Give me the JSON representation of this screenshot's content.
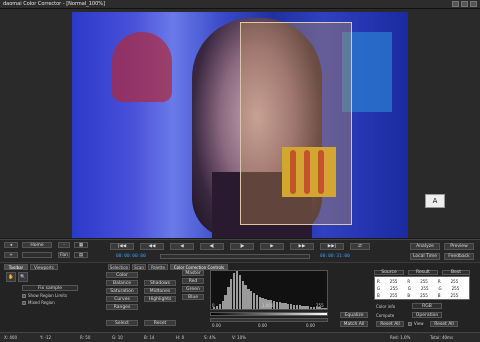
{
  "window": {
    "title": "daomai Color Corrector - [Normal_100%]"
  },
  "viewer": {
    "overlay_icon_label": "A"
  },
  "transport": {
    "left_controls": [
      "Home",
      "-",
      "Fan"
    ],
    "timecode_in": "00:00:00:00",
    "timecode_out": "00:00:31:00",
    "right_buttons": [
      "Analyze",
      "Preview",
      "Local Time",
      "Feedback"
    ]
  },
  "panel": {
    "tabs_left": [
      "Toolbar",
      "Viewports"
    ],
    "tabs_main": [
      "Selection",
      "Scan",
      "Palette",
      "Color Correction Controls"
    ],
    "left_options": [
      "Fix sample",
      "Show Region Limits",
      "Mixed Region"
    ],
    "left_buttons": [
      "Color",
      "Balance",
      "Saturation",
      "Curves",
      "Ranges",
      "Select"
    ],
    "mid_buttons": [
      "Shadows",
      "Midtones",
      "Highlights",
      "Reset"
    ],
    "rgb_buttons": [
      "Master",
      "Red",
      "Green",
      "Blue"
    ],
    "histo_labels": [
      "0",
      "1.000",
      "255"
    ],
    "slider_labels": [
      "0.00",
      "0.00",
      "0.00"
    ],
    "right_buttons": [
      "Equalize",
      "Match All"
    ],
    "table_headers": [
      "Source",
      "Result",
      "Best"
    ],
    "table_rows": [
      [
        "R",
        "255",
        "R",
        "255",
        "R",
        "255"
      ],
      [
        "G",
        "255",
        "G",
        "255",
        "G",
        "255"
      ],
      [
        "B",
        "255",
        "B",
        "255",
        "B",
        "255"
      ]
    ],
    "colorinfo_label": "Color info",
    "colorinfo_value": "RGB",
    "compute_label": "Compute",
    "compute_value": "Operation",
    "reset_all": "Reset All",
    "view_label": "View",
    "reset_label": "Reset All"
  },
  "status": {
    "items": [
      "X: 400",
      "Y: -12",
      "R: 50",
      "G: 10",
      "B: 14",
      "H: 0",
      "S: 4%",
      "V: 10%",
      "Red: 1.0%",
      "Total: 40ms"
    ]
  }
}
